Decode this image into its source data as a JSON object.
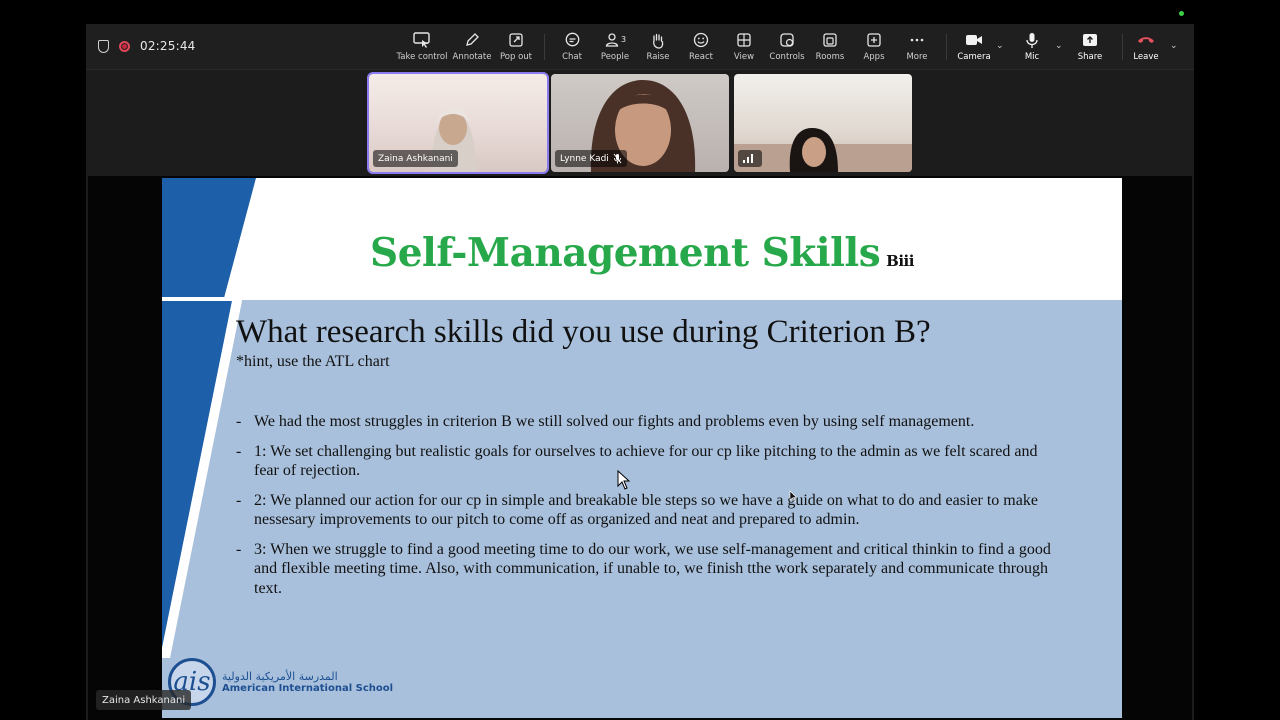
{
  "meeting": {
    "timer": "02:25:44"
  },
  "toolbar": {
    "buttons": [
      {
        "label": "Take control",
        "icon": "take-control-icon"
      },
      {
        "label": "Annotate",
        "icon": "pencil-icon"
      },
      {
        "label": "Pop out",
        "icon": "pop-out-icon"
      },
      {
        "label": "Chat",
        "icon": "chat-icon"
      },
      {
        "label": "People",
        "icon": "people-icon",
        "count": "3"
      },
      {
        "label": "Raise",
        "icon": "hand-icon"
      },
      {
        "label": "React",
        "icon": "smiley-icon"
      },
      {
        "label": "View",
        "icon": "grid-icon"
      },
      {
        "label": "Controls",
        "icon": "controls-icon"
      },
      {
        "label": "Rooms",
        "icon": "rooms-icon"
      },
      {
        "label": "Apps",
        "icon": "plus-square-icon"
      },
      {
        "label": "More",
        "icon": "ellipsis-icon"
      },
      {
        "label": "Camera",
        "icon": "camera-icon"
      },
      {
        "label": "Mic",
        "icon": "mic-icon"
      },
      {
        "label": "Share",
        "icon": "share-icon"
      },
      {
        "label": "Leave",
        "icon": "phone-hangup-icon"
      }
    ]
  },
  "participants": [
    {
      "name": "Zaina Ashkanani",
      "active": true
    },
    {
      "name": "Lynne Kadi",
      "muted": true
    },
    {
      "name": ""
    }
  ],
  "slide": {
    "title": "Self-Management Skills",
    "title_suffix": "Biii",
    "question": "What research skills did you use during Criterion B?",
    "hint": "*hint, use the ATL chart",
    "bullets": [
      "We had the most struggles in criterion  B we still solved our fights and problems even by using self management.",
      "1: We set  challenging but realistic  goals for ourselves to achieve for our cp like pitching to the admin as we felt scared and fear of rejection.",
      "2: We planned our action for our cp in simple and breakable ble steps so we have a guide on what to do and easier to make nessesary improvements to our pitch to come off as organized and neat and prepared to admin.",
      "3: When we struggle to find a good meeting time to do our work, we use self-management and critical thinkin  to find a good and flexible meeting time. Also, with communication, if unable to, we finish tthe work separately and communicate through text."
    ],
    "logo": {
      "mark": "ais",
      "arabic": "المدرسة الأمريكية الدولية",
      "english": "American International School"
    }
  },
  "presenter_label": "Zaina Ashkanani",
  "colors": {
    "title_green": "#27a84a",
    "slide_blue": "#a8c0dc",
    "band_blue": "#1d5fa8",
    "record_red": "#c5283d",
    "leave_red": "#e5505e"
  }
}
